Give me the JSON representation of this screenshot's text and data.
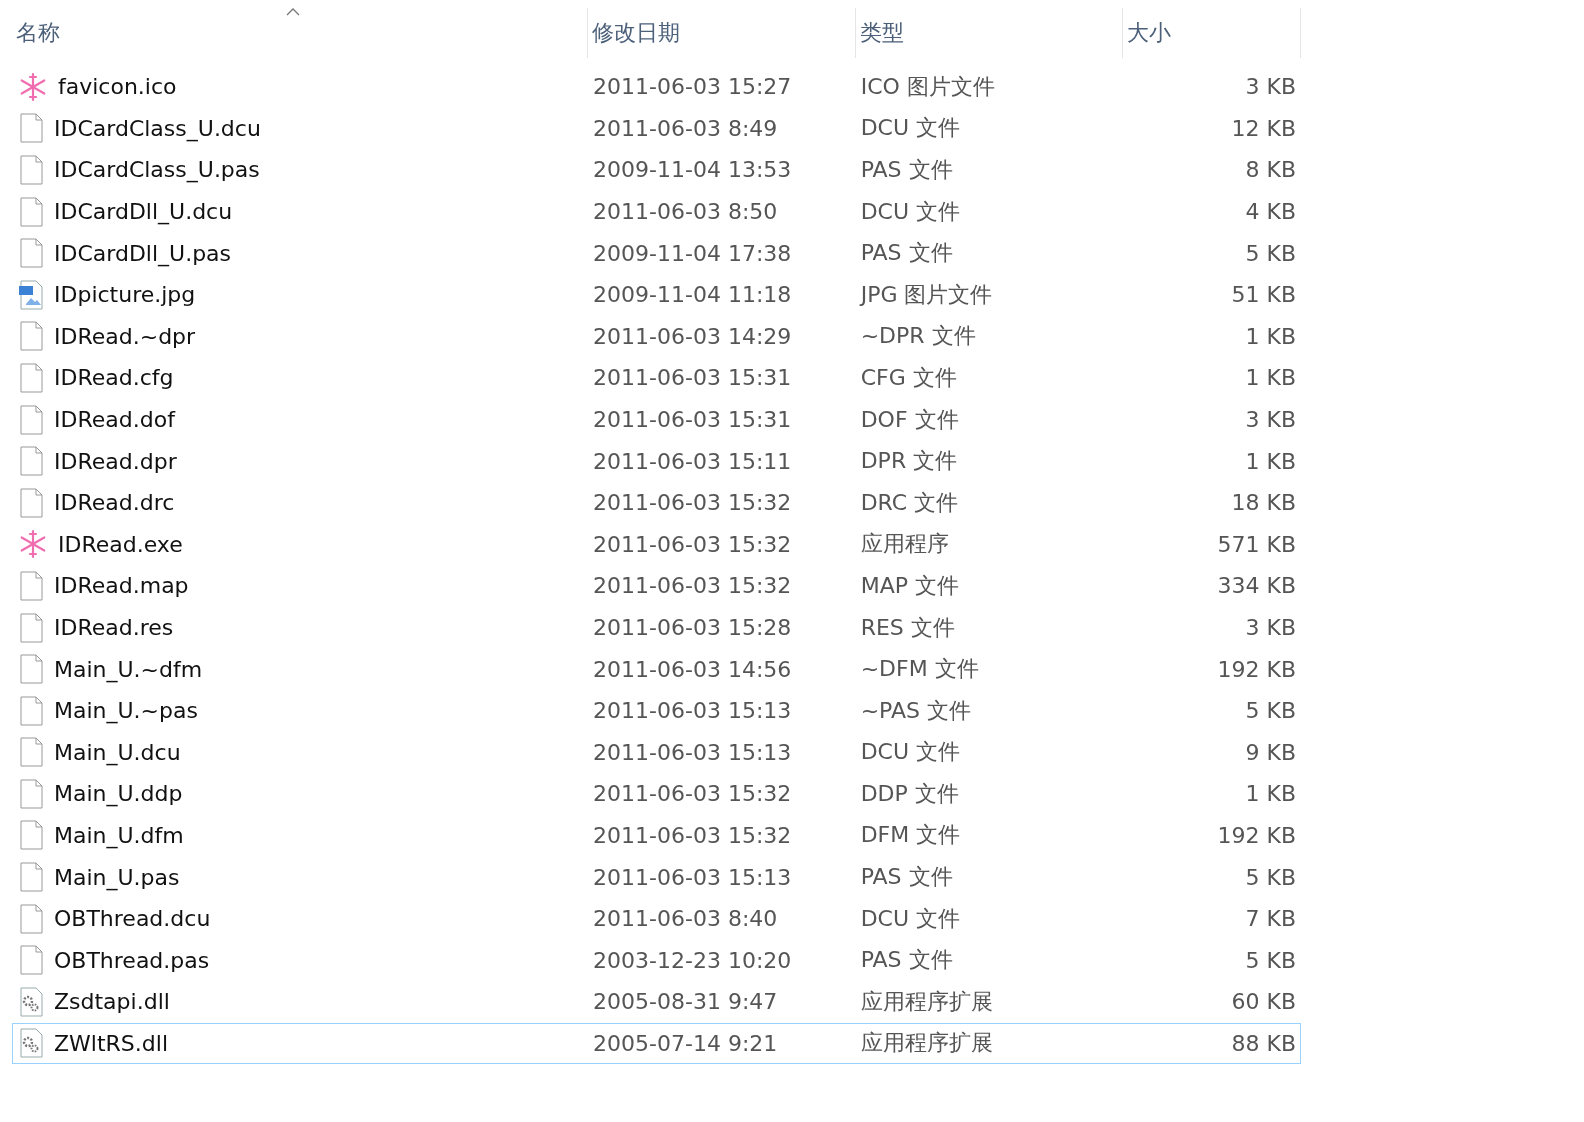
{
  "columns": [
    {
      "label": "名称",
      "sorted": true
    },
    {
      "label": "修改日期",
      "sorted": false
    },
    {
      "label": "类型",
      "sorted": false
    },
    {
      "label": "大小",
      "sorted": false
    }
  ],
  "files": [
    {
      "name": "favicon.ico",
      "modified": "2011-06-03 15:27",
      "type": "ICO 图片文件",
      "size": "3 KB",
      "kind": "snowflake",
      "focused": false
    },
    {
      "name": "IDCardClass_U.dcu",
      "modified": "2011-06-03 8:49",
      "type": "DCU 文件",
      "size": "12 KB",
      "kind": "blank",
      "focused": false
    },
    {
      "name": "IDCardClass_U.pas",
      "modified": "2009-11-04 13:53",
      "type": "PAS 文件",
      "size": "8 KB",
      "kind": "blank",
      "focused": false
    },
    {
      "name": "IDCardDll_U.dcu",
      "modified": "2011-06-03 8:50",
      "type": "DCU 文件",
      "size": "4 KB",
      "kind": "blank",
      "focused": false
    },
    {
      "name": "IDCardDll_U.pas",
      "modified": "2009-11-04 17:38",
      "type": "PAS 文件",
      "size": "5 KB",
      "kind": "blank",
      "focused": false
    },
    {
      "name": "IDpicture.jpg",
      "modified": "2009-11-04 11:18",
      "type": "JPG 图片文件",
      "size": "51 KB",
      "kind": "image",
      "focused": false
    },
    {
      "name": "IDRead.~dpr",
      "modified": "2011-06-03 14:29",
      "type": "~DPR 文件",
      "size": "1 KB",
      "kind": "blank",
      "focused": false
    },
    {
      "name": "IDRead.cfg",
      "modified": "2011-06-03 15:31",
      "type": "CFG 文件",
      "size": "1 KB",
      "kind": "blank",
      "focused": false
    },
    {
      "name": "IDRead.dof",
      "modified": "2011-06-03 15:31",
      "type": "DOF 文件",
      "size": "3 KB",
      "kind": "blank",
      "focused": false
    },
    {
      "name": "IDRead.dpr",
      "modified": "2011-06-03 15:11",
      "type": "DPR 文件",
      "size": "1 KB",
      "kind": "blank",
      "focused": false
    },
    {
      "name": "IDRead.drc",
      "modified": "2011-06-03 15:32",
      "type": "DRC 文件",
      "size": "18 KB",
      "kind": "blank",
      "focused": false
    },
    {
      "name": "IDRead.exe",
      "modified": "2011-06-03 15:32",
      "type": "应用程序",
      "size": "571 KB",
      "kind": "snowflake",
      "focused": false
    },
    {
      "name": "IDRead.map",
      "modified": "2011-06-03 15:32",
      "type": "MAP 文件",
      "size": "334 KB",
      "kind": "blank",
      "focused": false
    },
    {
      "name": "IDRead.res",
      "modified": "2011-06-03 15:28",
      "type": "RES 文件",
      "size": "3 KB",
      "kind": "blank",
      "focused": false
    },
    {
      "name": "Main_U.~dfm",
      "modified": "2011-06-03 14:56",
      "type": "~DFM 文件",
      "size": "192 KB",
      "kind": "blank",
      "focused": false
    },
    {
      "name": "Main_U.~pas",
      "modified": "2011-06-03 15:13",
      "type": "~PAS 文件",
      "size": "5 KB",
      "kind": "blank",
      "focused": false
    },
    {
      "name": "Main_U.dcu",
      "modified": "2011-06-03 15:13",
      "type": "DCU 文件",
      "size": "9 KB",
      "kind": "blank",
      "focused": false
    },
    {
      "name": "Main_U.ddp",
      "modified": "2011-06-03 15:32",
      "type": "DDP 文件",
      "size": "1 KB",
      "kind": "blank",
      "focused": false
    },
    {
      "name": "Main_U.dfm",
      "modified": "2011-06-03 15:32",
      "type": "DFM 文件",
      "size": "192 KB",
      "kind": "blank",
      "focused": false
    },
    {
      "name": "Main_U.pas",
      "modified": "2011-06-03 15:13",
      "type": "PAS 文件",
      "size": "5 KB",
      "kind": "blank",
      "focused": false
    },
    {
      "name": "OBThread.dcu",
      "modified": "2011-06-03 8:40",
      "type": "DCU 文件",
      "size": "7 KB",
      "kind": "blank",
      "focused": false
    },
    {
      "name": "OBThread.pas",
      "modified": "2003-12-23 10:20",
      "type": "PAS 文件",
      "size": "5 KB",
      "kind": "blank",
      "focused": false
    },
    {
      "name": "Zsdtapi.dll",
      "modified": "2005-08-31 9:47",
      "type": "应用程序扩展",
      "size": "60 KB",
      "kind": "gear",
      "focused": false
    },
    {
      "name": "ZWltRS.dll",
      "modified": "2005-07-14 9:21",
      "type": "应用程序扩展",
      "size": "88 KB",
      "kind": "gear",
      "focused": true
    }
  ]
}
